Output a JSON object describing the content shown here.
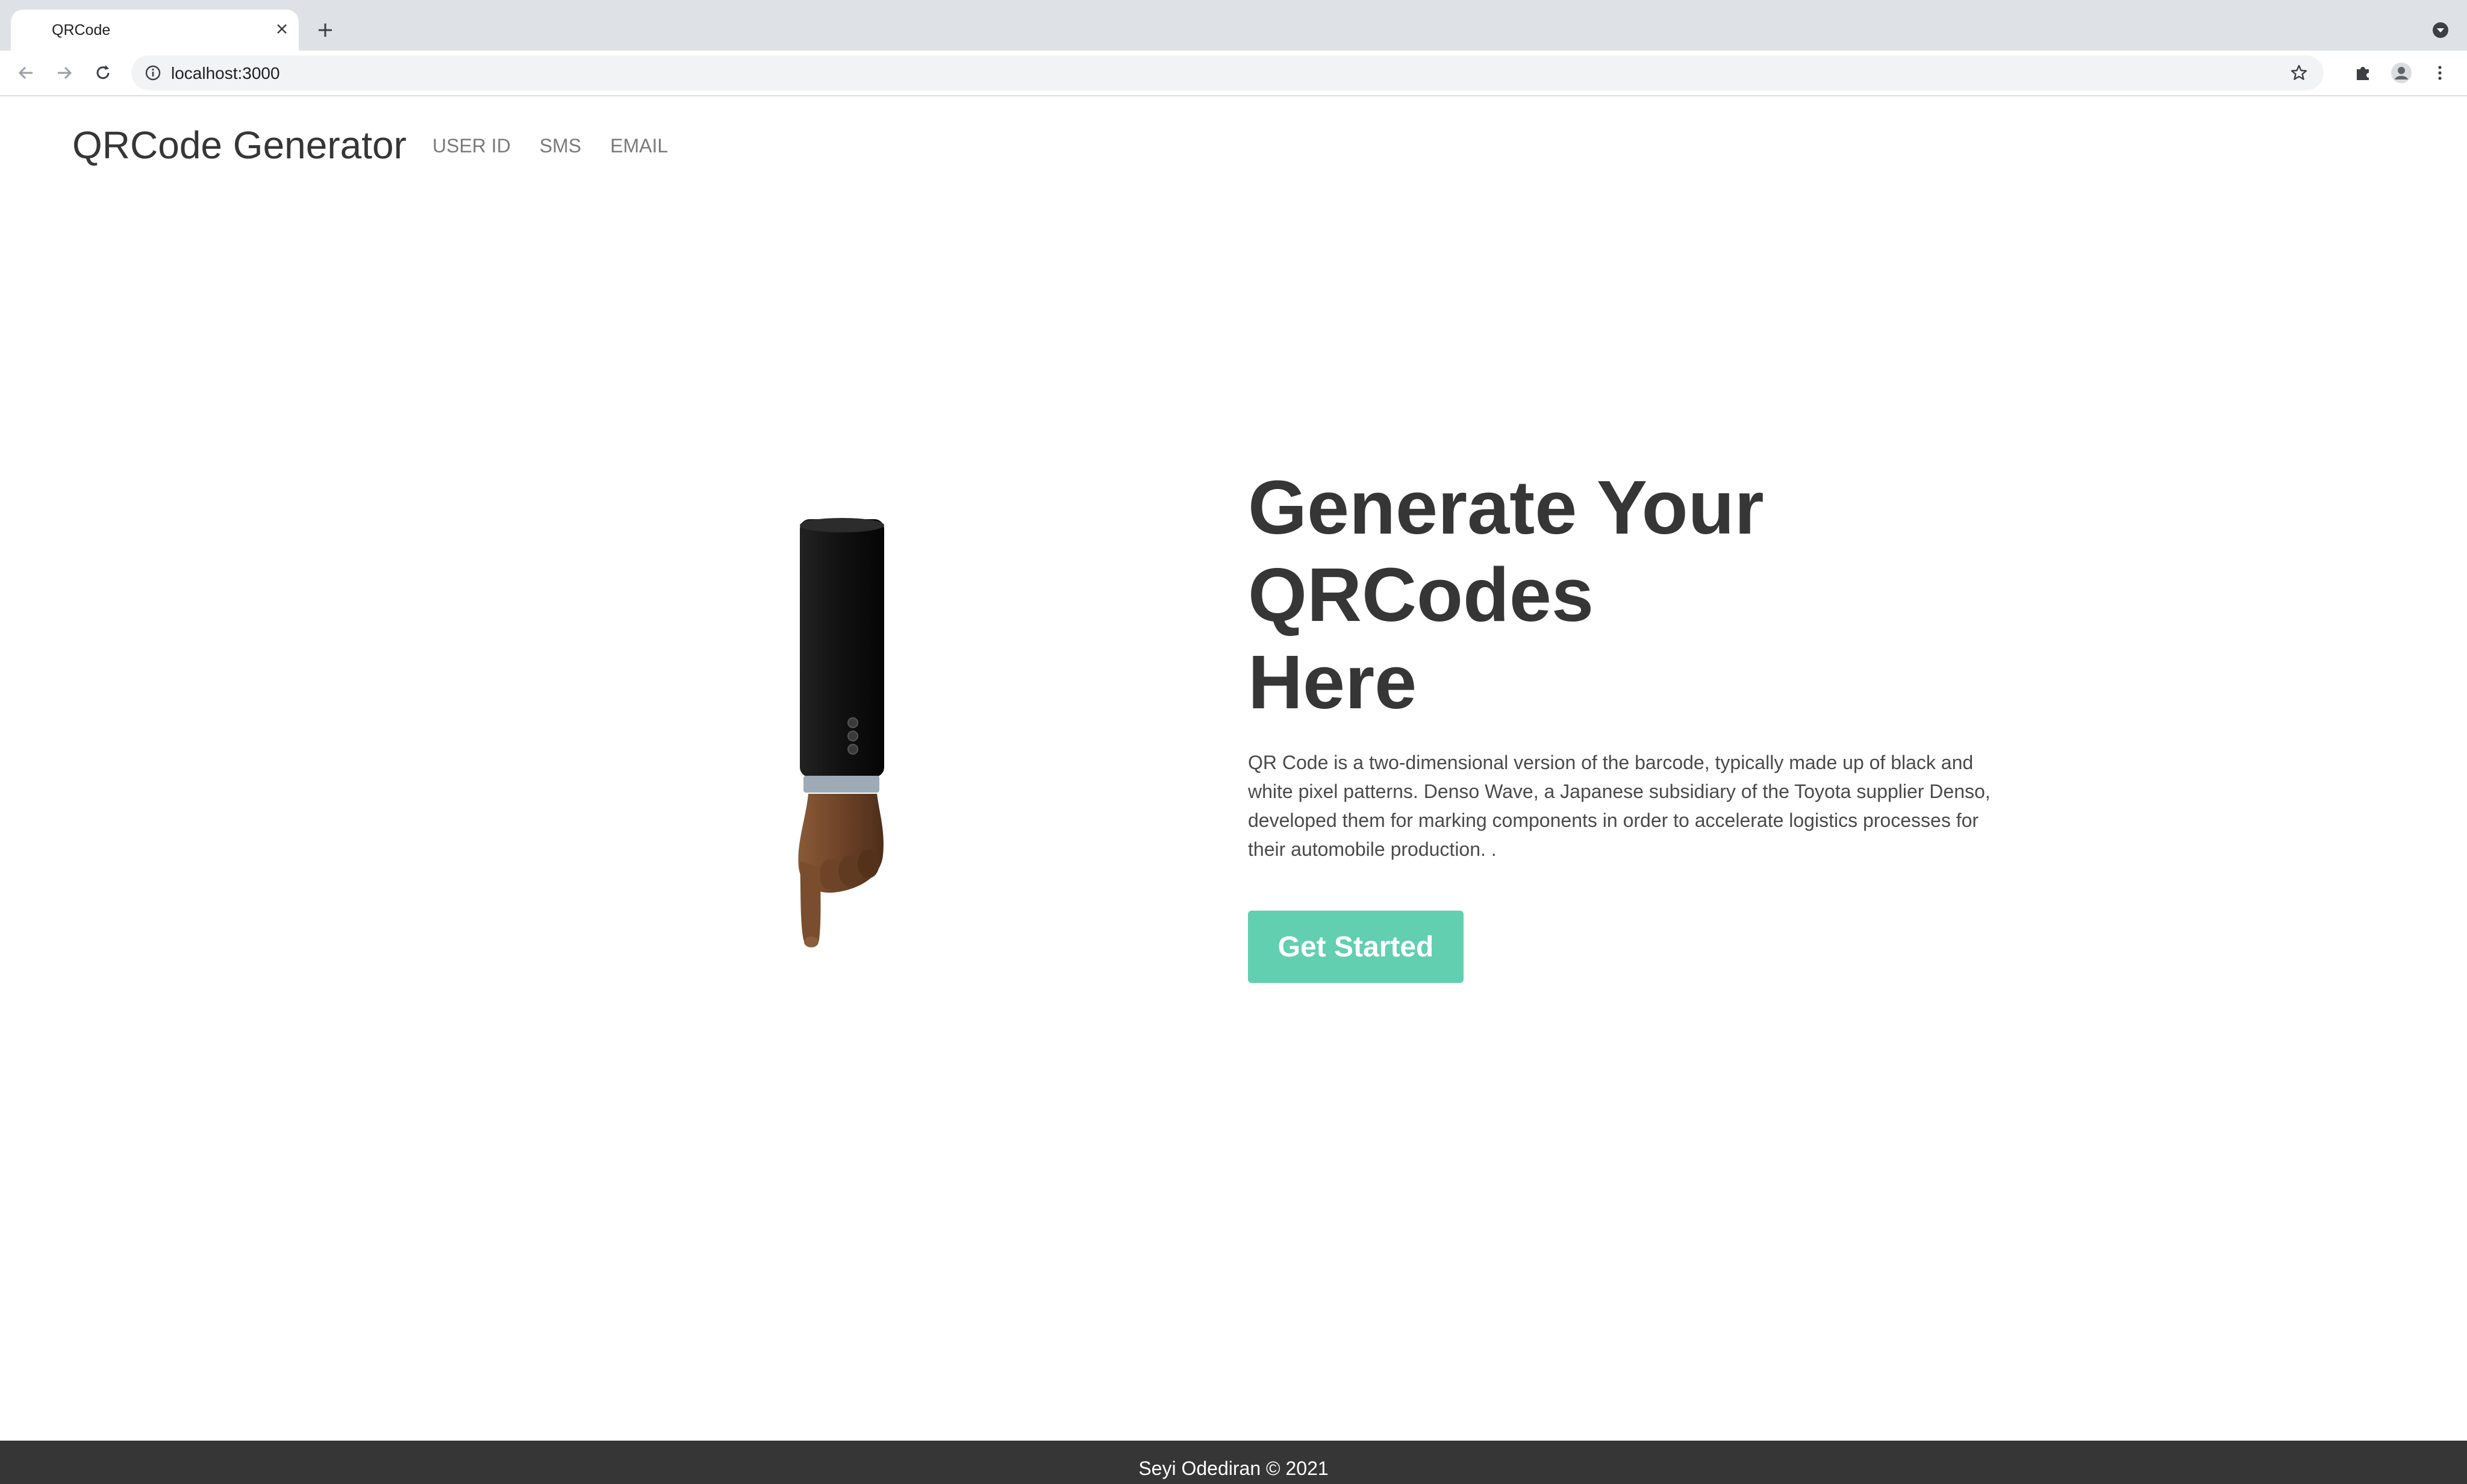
{
  "browser": {
    "tab_title": "QRCode",
    "url": "localhost:3000"
  },
  "navbar": {
    "brand": "QRCode Generator",
    "links": [
      "USER ID",
      "SMS",
      "EMAIL"
    ]
  },
  "hero": {
    "title_lines": [
      "Generate Your",
      "QRCodes",
      "Here"
    ],
    "description": "QR Code is a two-dimensional version of the barcode, typically made up of black and white pixel patterns. Denso Wave, a Japanese subsidiary of the Toyota supplier Denso, developed them for marking components in order to accelerate logistics processes for their automobile production. .",
    "cta_label": "Get Started",
    "illustration": "pointing-down-hand-illustration"
  },
  "footer": {
    "text": "Seyi Odediran © 2021"
  },
  "colors": {
    "accent": "#62cfb0",
    "text_dark": "#363636",
    "footer_bg": "#363636"
  }
}
